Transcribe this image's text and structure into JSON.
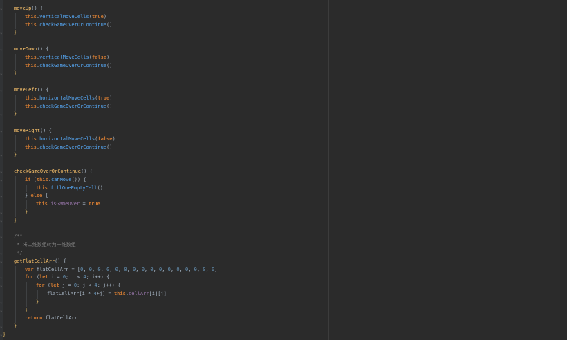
{
  "editor": {
    "theme": {
      "background": "#2b2b2b",
      "gutter": "#313335",
      "keyword": "#cc7832",
      "method": "#ffc66d",
      "comment": "#808080",
      "number": "#6897bb"
    },
    "lines": [
      {
        "indent": 1,
        "tokens": [
          [
            "fn",
            "moveUp"
          ],
          [
            "punct",
            "() {"
          ]
        ]
      },
      {
        "indent": 2,
        "tokens": [
          [
            "kw",
            "this"
          ],
          [
            "punct",
            "."
          ],
          [
            "mcall",
            "verticalMoveCells"
          ],
          [
            "punct",
            "("
          ],
          [
            "kw",
            "true"
          ],
          [
            "punct",
            ")"
          ]
        ]
      },
      {
        "indent": 2,
        "tokens": [
          [
            "kw",
            "this"
          ],
          [
            "punct",
            "."
          ],
          [
            "mcall",
            "checkGameOverOrContinue"
          ],
          [
            "punct",
            "()"
          ]
        ]
      },
      {
        "indent": 1,
        "tokens": [
          [
            "brace",
            "}"
          ]
        ]
      },
      {
        "indent": 0,
        "tokens": []
      },
      {
        "indent": 1,
        "tokens": [
          [
            "fn",
            "moveDown"
          ],
          [
            "punct",
            "() {"
          ]
        ]
      },
      {
        "indent": 2,
        "tokens": [
          [
            "kw",
            "this"
          ],
          [
            "punct",
            "."
          ],
          [
            "mcall",
            "verticalMoveCells"
          ],
          [
            "punct",
            "("
          ],
          [
            "kw",
            "false"
          ],
          [
            "punct",
            ")"
          ]
        ]
      },
      {
        "indent": 2,
        "tokens": [
          [
            "kw",
            "this"
          ],
          [
            "punct",
            "."
          ],
          [
            "mcall",
            "checkGameOverOrContinue"
          ],
          [
            "punct",
            "()"
          ]
        ]
      },
      {
        "indent": 1,
        "tokens": [
          [
            "brace",
            "}"
          ]
        ]
      },
      {
        "indent": 0,
        "tokens": []
      },
      {
        "indent": 1,
        "tokens": [
          [
            "fn",
            "moveLeft"
          ],
          [
            "punct",
            "() {"
          ]
        ]
      },
      {
        "indent": 2,
        "tokens": [
          [
            "kw",
            "this"
          ],
          [
            "punct",
            "."
          ],
          [
            "mcall",
            "horizontalMoveCells"
          ],
          [
            "punct",
            "("
          ],
          [
            "kw",
            "true"
          ],
          [
            "punct",
            ")"
          ]
        ]
      },
      {
        "indent": 2,
        "tokens": [
          [
            "kw",
            "this"
          ],
          [
            "punct",
            "."
          ],
          [
            "mcall",
            "checkGameOverOrContinue"
          ],
          [
            "punct",
            "()"
          ]
        ]
      },
      {
        "indent": 1,
        "tokens": [
          [
            "brace",
            "}"
          ]
        ]
      },
      {
        "indent": 0,
        "tokens": []
      },
      {
        "indent": 1,
        "tokens": [
          [
            "fn",
            "moveRight"
          ],
          [
            "punct",
            "() {"
          ]
        ]
      },
      {
        "indent": 2,
        "tokens": [
          [
            "kw",
            "this"
          ],
          [
            "punct",
            "."
          ],
          [
            "mcall",
            "horizontalMoveCells"
          ],
          [
            "punct",
            "("
          ],
          [
            "kw",
            "false"
          ],
          [
            "punct",
            ")"
          ]
        ]
      },
      {
        "indent": 2,
        "tokens": [
          [
            "kw",
            "this"
          ],
          [
            "punct",
            "."
          ],
          [
            "mcall",
            "checkGameOverOrContinue"
          ],
          [
            "punct",
            "()"
          ]
        ]
      },
      {
        "indent": 1,
        "tokens": [
          [
            "brace",
            "}"
          ]
        ]
      },
      {
        "indent": 0,
        "tokens": []
      },
      {
        "indent": 1,
        "tokens": [
          [
            "fn",
            "checkGameOverOrContinue"
          ],
          [
            "punct",
            "() {"
          ]
        ]
      },
      {
        "indent": 2,
        "tokens": [
          [
            "kw",
            "if"
          ],
          [
            "punct",
            " ("
          ],
          [
            "kw",
            "this"
          ],
          [
            "punct",
            "."
          ],
          [
            "mcall",
            "canMove"
          ],
          [
            "punct",
            "()) {"
          ]
        ]
      },
      {
        "indent": 3,
        "tokens": [
          [
            "kw",
            "this"
          ],
          [
            "punct",
            "."
          ],
          [
            "mcall",
            "fillOneEmptyCell"
          ],
          [
            "punct",
            "()"
          ]
        ]
      },
      {
        "indent": 2,
        "tokens": [
          [
            "punct",
            "} "
          ],
          [
            "kw",
            "else"
          ],
          [
            "punct",
            " {"
          ]
        ]
      },
      {
        "indent": 3,
        "tokens": [
          [
            "kw",
            "this"
          ],
          [
            "punct",
            "."
          ],
          [
            "prop",
            "isGameOver"
          ],
          [
            "punct",
            " = "
          ],
          [
            "kw",
            "true"
          ]
        ]
      },
      {
        "indent": 2,
        "tokens": [
          [
            "brace",
            "}"
          ]
        ]
      },
      {
        "indent": 1,
        "tokens": [
          [
            "brace",
            "}"
          ]
        ]
      },
      {
        "indent": 0,
        "tokens": []
      },
      {
        "indent": 1,
        "tokens": [
          [
            "cmt",
            "/**"
          ]
        ]
      },
      {
        "indent": 1,
        "tokens": [
          [
            "cmt",
            " * 将二维数组转为一维数组"
          ]
        ]
      },
      {
        "indent": 1,
        "tokens": [
          [
            "cmt",
            " */"
          ]
        ]
      },
      {
        "indent": 1,
        "tokens": [
          [
            "fn",
            "getFlatCellArr"
          ],
          [
            "punct",
            "() {"
          ]
        ]
      },
      {
        "indent": 2,
        "tokens": [
          [
            "kw",
            "var"
          ],
          [
            "plain",
            " flatCellArr = ["
          ],
          [
            "num",
            "0"
          ],
          [
            "punct",
            ", "
          ],
          [
            "num",
            "0"
          ],
          [
            "punct",
            ", "
          ],
          [
            "num",
            "0"
          ],
          [
            "punct",
            ", "
          ],
          [
            "num",
            "0"
          ],
          [
            "punct",
            ", "
          ],
          [
            "num",
            "0"
          ],
          [
            "punct",
            ", "
          ],
          [
            "num",
            "0"
          ],
          [
            "punct",
            ", "
          ],
          [
            "num",
            "0"
          ],
          [
            "punct",
            ", "
          ],
          [
            "num",
            "0"
          ],
          [
            "punct",
            ", "
          ],
          [
            "num",
            "0"
          ],
          [
            "punct",
            ", "
          ],
          [
            "num",
            "0"
          ],
          [
            "punct",
            ", "
          ],
          [
            "num",
            "0"
          ],
          [
            "punct",
            ", "
          ],
          [
            "num",
            "0"
          ],
          [
            "punct",
            ", "
          ],
          [
            "num",
            "0"
          ],
          [
            "punct",
            ", "
          ],
          [
            "num",
            "0"
          ],
          [
            "punct",
            ", "
          ],
          [
            "num",
            "0"
          ],
          [
            "punct",
            ", "
          ],
          [
            "num",
            "0"
          ],
          [
            "punct",
            "]"
          ]
        ]
      },
      {
        "indent": 2,
        "tokens": [
          [
            "kw",
            "for"
          ],
          [
            "punct",
            " ("
          ],
          [
            "kw",
            "let"
          ],
          [
            "plain",
            " i = "
          ],
          [
            "num",
            "0"
          ],
          [
            "punct",
            "; "
          ],
          [
            "plain",
            "i < "
          ],
          [
            "num",
            "4"
          ],
          [
            "punct",
            "; "
          ],
          [
            "plain",
            "i++) {"
          ]
        ]
      },
      {
        "indent": 3,
        "tokens": [
          [
            "kw",
            "for"
          ],
          [
            "punct",
            " ("
          ],
          [
            "kw",
            "let"
          ],
          [
            "plain",
            " j = "
          ],
          [
            "num",
            "0"
          ],
          [
            "punct",
            "; "
          ],
          [
            "plain",
            "j < "
          ],
          [
            "num",
            "4"
          ],
          [
            "punct",
            "; "
          ],
          [
            "plain",
            "j++) {"
          ]
        ]
      },
      {
        "indent": 4,
        "tokens": [
          [
            "plain",
            "flatCellArr[i * "
          ],
          [
            "num",
            "4"
          ],
          [
            "plain",
            "+j] = "
          ],
          [
            "kw",
            "this"
          ],
          [
            "punct",
            "."
          ],
          [
            "prop",
            "cellArr"
          ],
          [
            "plain",
            "[i][j]"
          ]
        ]
      },
      {
        "indent": 3,
        "tokens": [
          [
            "brace",
            "}"
          ]
        ]
      },
      {
        "indent": 2,
        "tokens": [
          [
            "brace",
            "}"
          ]
        ]
      },
      {
        "indent": 2,
        "tokens": [
          [
            "kw",
            "return"
          ],
          [
            "plain",
            " flatCellArr"
          ]
        ]
      },
      {
        "indent": 1,
        "tokens": [
          [
            "brace",
            "}"
          ]
        ]
      },
      {
        "indent": 0,
        "tokens": [
          [
            "brace",
            "}"
          ]
        ]
      }
    ]
  }
}
